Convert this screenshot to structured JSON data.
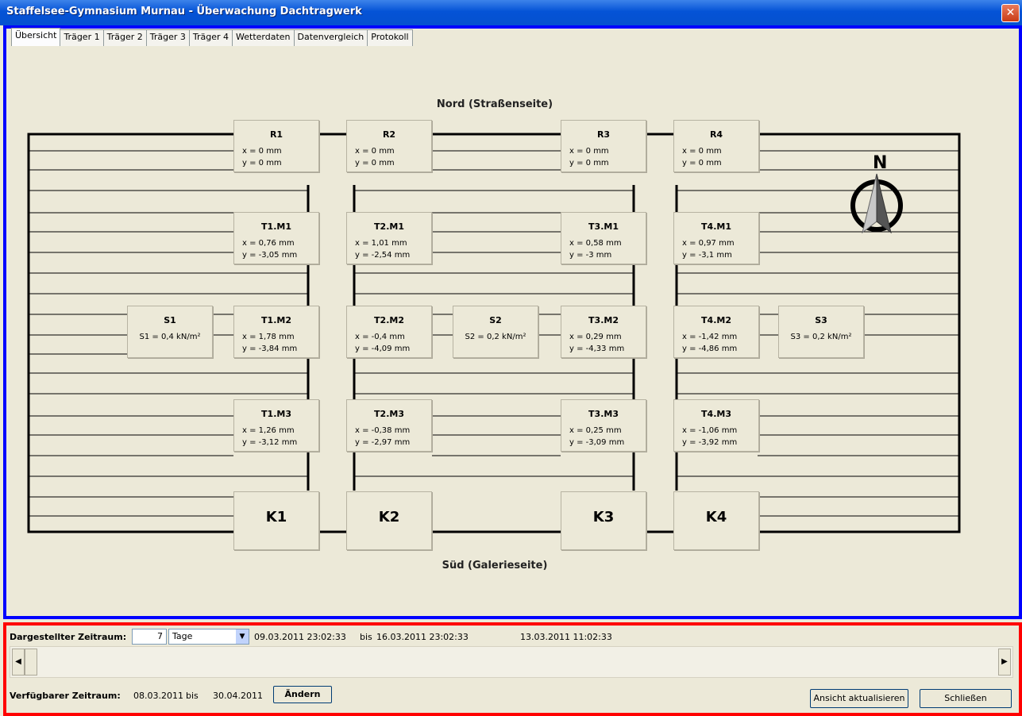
{
  "window": {
    "title": "Staffelsee-Gymnasium Murnau - Überwachung Dachtragwerk",
    "close": "✕"
  },
  "tabs": [
    "Übersicht",
    "Träger 1",
    "Träger 2",
    "Träger 3",
    "Träger 4",
    "Wetterdaten",
    "Datenvergleich",
    "Protokoll"
  ],
  "diagram": {
    "north_label": "Nord (Straßenseite)",
    "south_label": "Süd (Galerieseite)",
    "compass_letter": "N",
    "nodes": {
      "R1": {
        "title": "R1",
        "x": "x = 0 mm",
        "y": "y = 0 mm"
      },
      "R2": {
        "title": "R2",
        "x": "x = 0 mm",
        "y": "y = 0 mm"
      },
      "R3": {
        "title": "R3",
        "x": "x = 0 mm",
        "y": "y = 0 mm"
      },
      "R4": {
        "title": "R4",
        "x": "x = 0 mm",
        "y": "y = 0 mm"
      },
      "T1M1": {
        "title": "T1.M1",
        "x": "x = 0,76 mm",
        "y": "y = -3,05 mm"
      },
      "T2M1": {
        "title": "T2.M1",
        "x": "x = 1,01 mm",
        "y": "y = -2,54 mm"
      },
      "T3M1": {
        "title": "T3.M1",
        "x": "x = 0,58 mm",
        "y": "y = -3 mm"
      },
      "T4M1": {
        "title": "T4.M1",
        "x": "x = 0,97 mm",
        "y": "y = -3,1 mm"
      },
      "T1M2": {
        "title": "T1.M2",
        "x": "x = 1,78 mm",
        "y": "y = -3,84 mm"
      },
      "T2M2": {
        "title": "T2.M2",
        "x": "x = -0,4 mm",
        "y": "y = -4,09 mm"
      },
      "T3M2": {
        "title": "T3.M2",
        "x": "x = 0,29 mm",
        "y": "y = -4,33 mm"
      },
      "T4M2": {
        "title": "T4.M2",
        "x": "x = -1,42 mm",
        "y": "y = -4,86 mm"
      },
      "T1M3": {
        "title": "T1.M3",
        "x": "x = 1,26 mm",
        "y": "y = -3,12 mm"
      },
      "T2M3": {
        "title": "T2.M3",
        "x": "x = -0,38 mm",
        "y": "y = -2,97 mm"
      },
      "T3M3": {
        "title": "T3.M3",
        "x": "x = 0,25 mm",
        "y": "y = -3,09 mm"
      },
      "T4M3": {
        "title": "T4.M3",
        "x": "x = -1,06 mm",
        "y": "y = -3,92 mm"
      },
      "S1": {
        "title": "S1",
        "v": "S1 = 0,4 kN/m²"
      },
      "S2": {
        "title": "S2",
        "v": "S2 = 0,2 kN/m²"
      },
      "S3": {
        "title": "S3",
        "v": "S3 = 0,2 kN/m²"
      },
      "K1": {
        "title": "K1"
      },
      "K2": {
        "title": "K2"
      },
      "K3": {
        "title": "K3"
      },
      "K4": {
        "title": "K4"
      }
    }
  },
  "timerange": {
    "label": "Dargestellter Zeitraum:",
    "amount": "7",
    "unit": "Tage",
    "from": "09.03.2011 23:02:33",
    "bis": "bis",
    "to": "16.03.2011 23:02:33",
    "current": "13.03.2011 11:02:33",
    "available_label": "Verfügbarer Zeitraum:",
    "available_from": "08.03.2011",
    "available_bis": "bis",
    "available_to": "30.04.2011",
    "change_btn": "Ändern",
    "refresh_btn": "Ansicht aktualisieren",
    "close_btn": "Schließen"
  }
}
